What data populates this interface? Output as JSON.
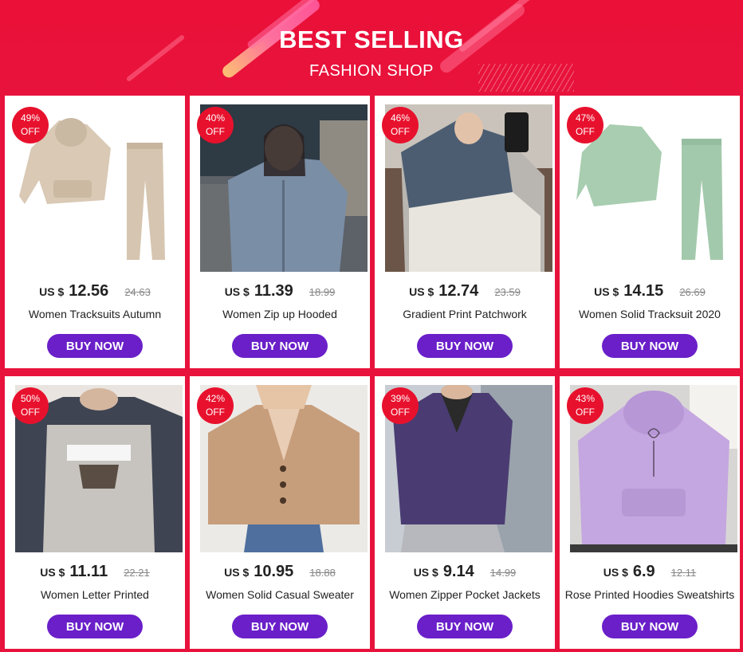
{
  "banner": {
    "title": "BEST SELLING",
    "subtitle": "FASHION SHOP"
  },
  "colors": {
    "background": "#e8133c",
    "badge": "#e8112d",
    "button": "#6a1fc9"
  },
  "currency_label": "US $",
  "button_label": "BUY NOW",
  "products": [
    {
      "discount": "49%",
      "off": "OFF",
      "price": "12.56",
      "old_price": "24.63",
      "name": "Women Tracksuits Autumn",
      "image": "beige-tracksuit"
    },
    {
      "discount": "40%",
      "off": "OFF",
      "price": "11.39",
      "old_price": "18.99",
      "name": "Women Zip up Hooded",
      "image": "blue-zip-hoodie"
    },
    {
      "discount": "46%",
      "off": "OFF",
      "price": "12.74",
      "old_price": "23.59",
      "name": "Gradient Print Patchwork",
      "image": "gray-patchwork-hoodie"
    },
    {
      "discount": "47%",
      "off": "OFF",
      "price": "14.15",
      "old_price": "26.69",
      "name": "Women Solid Tracksuit 2020",
      "image": "green-tracksuit"
    },
    {
      "discount": "50%",
      "off": "OFF",
      "price": "11.11",
      "old_price": "22.21",
      "name": "Women Letter Printed",
      "image": "alaska-sweatshirt"
    },
    {
      "discount": "42%",
      "off": "OFF",
      "price": "10.95",
      "old_price": "18.88",
      "name": "Women Solid Casual Sweater",
      "image": "tan-cardigan"
    },
    {
      "discount": "39%",
      "off": "OFF",
      "price": "9.14",
      "old_price": "14.99",
      "name": "Women Zipper Pocket Jackets",
      "image": "purple-jacket"
    },
    {
      "discount": "43%",
      "off": "OFF",
      "price": "6.9",
      "old_price": "12.11",
      "name": "Rose Printed Hoodies Sweatshirts",
      "image": "lilac-rose-hoodie"
    }
  ]
}
